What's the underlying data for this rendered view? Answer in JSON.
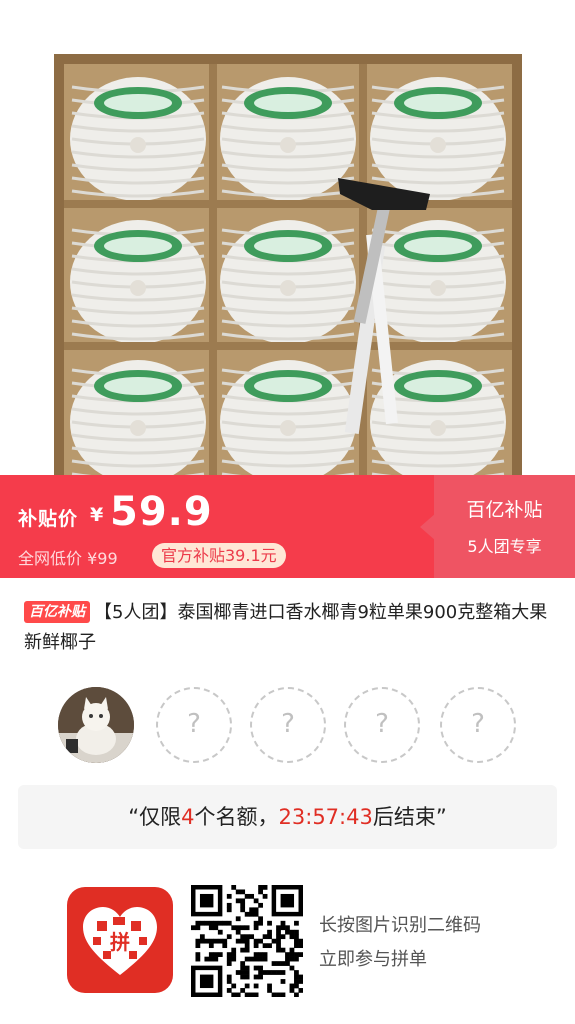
{
  "banner": {
    "subsidy_label": "补贴价",
    "currency": "¥",
    "price": "59.9",
    "original_price": "全网低价 ¥99",
    "discount_pill": "官方补贴39.1元",
    "badge_title": "百亿补贴",
    "badge_subtitle": "5人团专享",
    "colors": {
      "main": "#f53c4b",
      "side": "#ef5463",
      "pill_bg": "#ffe7d6",
      "pill_text": "#ec3b4a"
    }
  },
  "title": {
    "tag": "百亿补贴",
    "text": "【5人团】泰国椰青进口香水椰青9粒单果900克整箱大果新鲜椰子"
  },
  "group": {
    "slots": [
      "?",
      "?",
      "?",
      "?"
    ]
  },
  "countdown": {
    "prefix": "“仅限",
    "count": "4",
    "middle": "个名额，",
    "time": "23:57:43",
    "suffix": "后结束”"
  },
  "share": {
    "hint_line1": "长按图片识别二维码",
    "hint_line2": "立即参与拼单",
    "app_icon_text": "拼"
  }
}
